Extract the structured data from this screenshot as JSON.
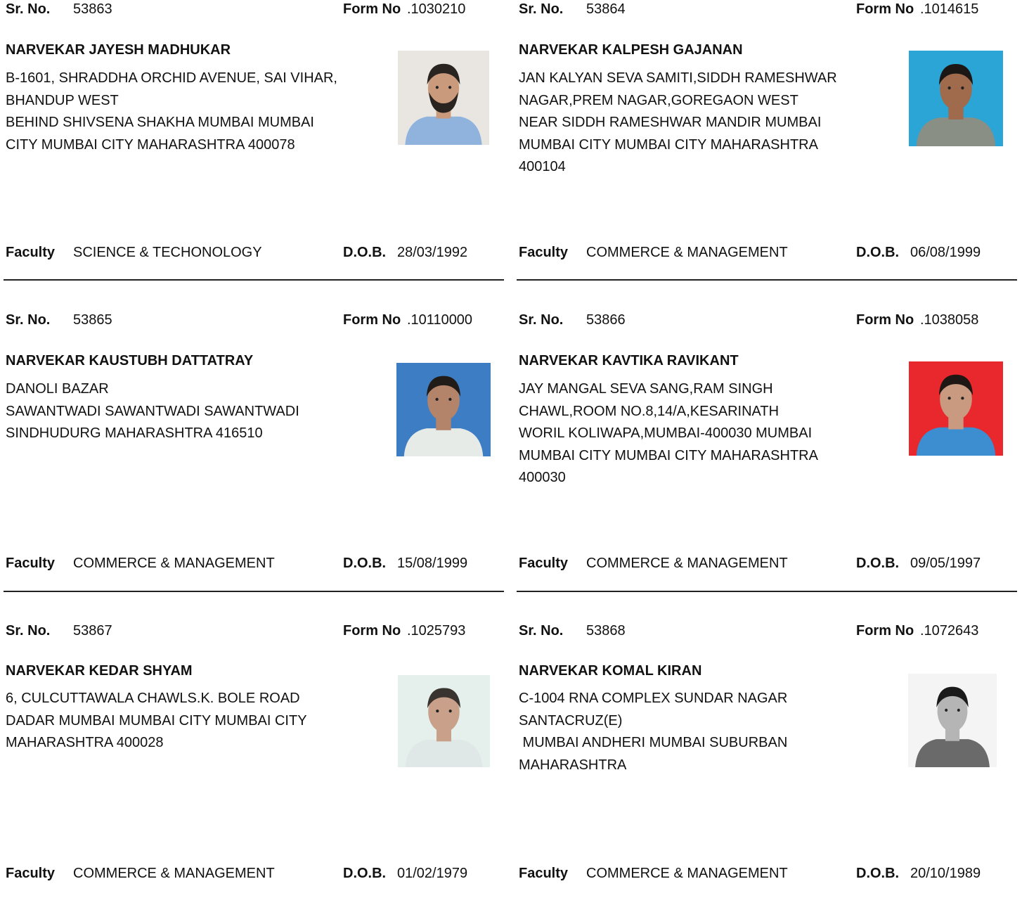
{
  "labels": {
    "sr_no": "Sr. No.",
    "form_no": "Form No",
    "faculty": "Faculty",
    "dob": "D.O.B."
  },
  "records": [
    {
      "sr_no": "53863",
      "form_no": ".1030210",
      "name": "NARVEKAR JAYESH MADHUKAR",
      "address_lines": [
        "B-1601, SHRADDHA ORCHID AVENUE, SAI VIHAR,",
        "BHANDUP WEST",
        "BEHIND SHIVSENA SHAKHA MUMBAI MUMBAI",
        "CITY MUMBAI CITY MAHARASHTRA 400078",
        ""
      ],
      "faculty": "SCIENCE & TECHONOLOGY",
      "dob": "28/03/1992",
      "photo": {
        "bg": "#e9e6e1",
        "shirt": "#8fb3dc",
        "skin": "#c99a7c",
        "hair": "#2a2420",
        "beard": true
      }
    },
    {
      "sr_no": "53864",
      "form_no": ".1014615",
      "name": "NARVEKAR KALPESH GAJANAN",
      "address_lines": [
        "JAN KALYAN SEVA SAMITI,SIDDH RAMESHWAR",
        "NAGAR,PREM NAGAR,GOREGAON WEST",
        "NEAR SIDDH RAMESHWAR MANDIR MUMBAI",
        "MUMBAI CITY MUMBAI CITY MAHARASHTRA",
        "400104"
      ],
      "faculty": "COMMERCE & MANAGEMENT",
      "dob": "06/08/1999",
      "photo": {
        "bg": "#2aa5d6",
        "shirt": "#8a8f86",
        "skin": "#a06a4c",
        "hair": "#1c1714",
        "beard": false
      }
    },
    {
      "sr_no": "53865",
      "form_no": ".10110000",
      "name": "NARVEKAR KAUSTUBH DATTATRAY",
      "address_lines": [
        "DANOLI BAZAR",
        "SAWANTWADI SAWANTWADI SAWANTWADI",
        "SINDHUDURG MAHARASHTRA 416510",
        "",
        ""
      ],
      "faculty": "COMMERCE & MANAGEMENT",
      "dob": "15/08/1999",
      "photo": {
        "bg": "#3c7dc4",
        "shirt": "#e6ebe8",
        "skin": "#b3836a",
        "hair": "#221c18",
        "beard": false
      }
    },
    {
      "sr_no": "53866",
      "form_no": ".1038058",
      "name": "NARVEKAR KAVTIKA RAVIKANT",
      "address_lines": [
        "JAY MANGAL SEVA SANG,RAM SINGH",
        "CHAWL,ROOM NO.8,14/A,KESARINATH",
        "WORIL KOLIWAPA,MUMBAI-400030 MUMBAI",
        "MUMBAI CITY MUMBAI CITY MAHARASHTRA",
        "400030"
      ],
      "faculty": "COMMERCE & MANAGEMENT",
      "dob": "09/05/1997",
      "photo": {
        "bg": "#e8282c",
        "shirt": "#3d8ed0",
        "skin": "#c99a80",
        "hair": "#1e1714",
        "beard": false
      }
    },
    {
      "sr_no": "53867",
      "form_no": ".1025793",
      "name": "NARVEKAR KEDAR SHYAM",
      "address_lines": [
        "6, CULCUTTAWALA CHAWLS.K. BOLE ROAD",
        "DADAR MUMBAI MUMBAI CITY MUMBAI CITY",
        "MAHARASHTRA 400028",
        "",
        ""
      ],
      "faculty": "COMMERCE & MANAGEMENT",
      "dob": "01/02/1979",
      "photo": {
        "bg": "#e5f0ec",
        "shirt": "#dfe8e6",
        "skin": "#c9a08a",
        "hair": "#3a3430",
        "beard": false
      }
    },
    {
      "sr_no": "53868",
      "form_no": ".1072643",
      "name": "NARVEKAR KOMAL KIRAN",
      "address_lines": [
        "C-1004  RNA COMPLEX SUNDAR NAGAR",
        "SANTACRUZ(E)",
        " MUMBAI ANDHERI MUMBAI SUBURBAN",
        "MAHARASHTRA",
        ""
      ],
      "faculty": "COMMERCE & MANAGEMENT",
      "dob": "20/10/1989",
      "photo": {
        "bg": "#f4f4f4",
        "shirt": "#6a6a6a",
        "skin": "#b5b5b5",
        "hair": "#1a1a1a",
        "beard": false
      }
    }
  ]
}
